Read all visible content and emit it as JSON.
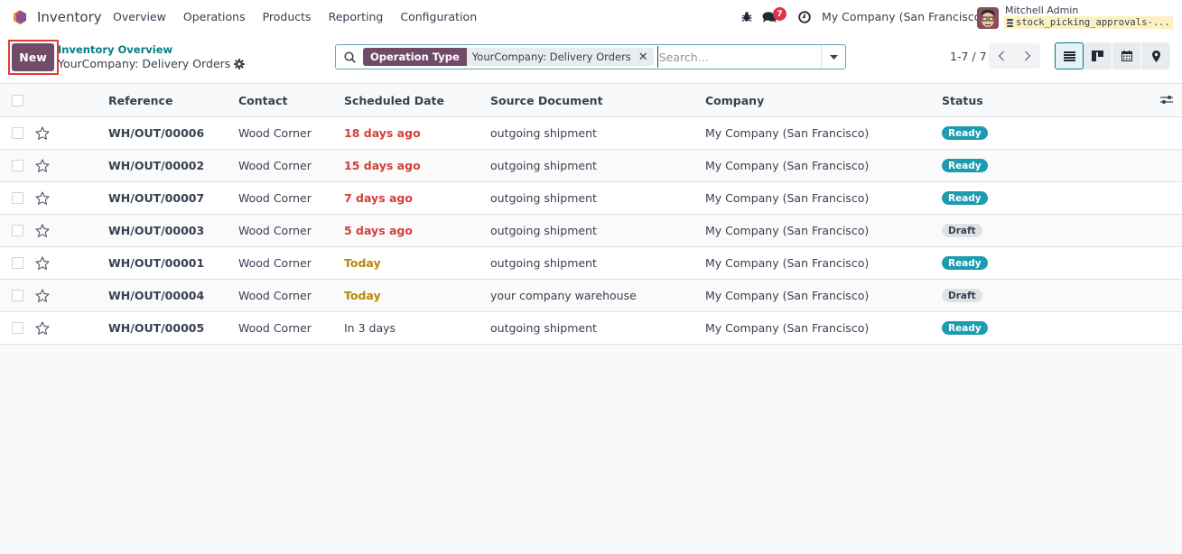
{
  "navbar": {
    "app_name": "Inventory",
    "menu": [
      "Overview",
      "Operations",
      "Products",
      "Reporting",
      "Configuration"
    ],
    "message_count": "7",
    "company": "My Company (San Francisco)",
    "user_name": "Mitchell Admin",
    "database": "stock_picking_approvals-..."
  },
  "control_panel": {
    "new_label": "New",
    "breadcrumb_parent": "Inventory Overview",
    "page_title": "YourCompany: Delivery Orders",
    "search": {
      "facet_label": "Operation Type",
      "facet_value": "YourCompany: Delivery Orders",
      "placeholder": "Search...",
      "value": ""
    },
    "pager": "1-7 / 7",
    "views": [
      "list",
      "kanban",
      "calendar",
      "map"
    ],
    "active_view": "list"
  },
  "list": {
    "columns": [
      "Reference",
      "Contact",
      "Scheduled Date",
      "Source Document",
      "Company",
      "Status"
    ],
    "rows": [
      {
        "reference": "WH/OUT/00006",
        "contact": "Wood Corner",
        "scheduled_date": "18 days ago",
        "date_state": "late",
        "source": "outgoing shipment",
        "company": "My Company (San Francisco)",
        "status": "Ready"
      },
      {
        "reference": "WH/OUT/00002",
        "contact": "Wood Corner",
        "scheduled_date": "15 days ago",
        "date_state": "late",
        "source": "outgoing shipment",
        "company": "My Company (San Francisco)",
        "status": "Ready"
      },
      {
        "reference": "WH/OUT/00007",
        "contact": "Wood Corner",
        "scheduled_date": "7 days ago",
        "date_state": "late",
        "source": "outgoing shipment",
        "company": "My Company (San Francisco)",
        "status": "Ready"
      },
      {
        "reference": "WH/OUT/00003",
        "contact": "Wood Corner",
        "scheduled_date": "5 days ago",
        "date_state": "late",
        "source": "outgoing shipment",
        "company": "My Company (San Francisco)",
        "status": "Draft"
      },
      {
        "reference": "WH/OUT/00001",
        "contact": "Wood Corner",
        "scheduled_date": "Today",
        "date_state": "today",
        "source": "outgoing shipment",
        "company": "My Company (San Francisco)",
        "status": "Ready"
      },
      {
        "reference": "WH/OUT/00004",
        "contact": "Wood Corner",
        "scheduled_date": "Today",
        "date_state": "today",
        "source": "your company warehouse",
        "company": "My Company (San Francisco)",
        "status": "Draft"
      },
      {
        "reference": "WH/OUT/00005",
        "contact": "Wood Corner",
        "scheduled_date": "In 3 days",
        "date_state": "future",
        "source": "outgoing shipment",
        "company": "My Company (San Francisco)",
        "status": "Ready"
      }
    ]
  },
  "colors": {
    "brand": "#714b67",
    "link": "#017e84",
    "late": "#d23f3a",
    "today": "#b8860b",
    "ready": "#1d9bb0",
    "draft": "#dee2e6"
  }
}
